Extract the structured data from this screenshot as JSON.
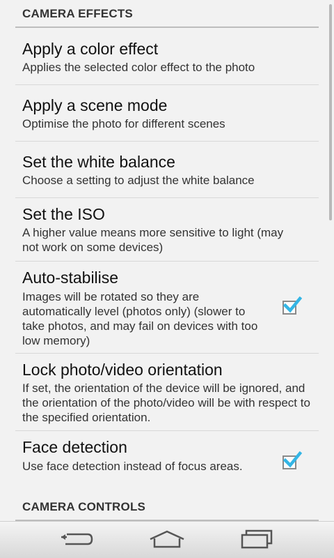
{
  "sections": {
    "camera_effects": "CAMERA EFFECTS",
    "camera_controls": "CAMERA CONTROLS"
  },
  "prefs": {
    "color_effect": {
      "title": "Apply a color effect",
      "summary": "Applies the selected color effect to the photo"
    },
    "scene_mode": {
      "title": "Apply a scene mode",
      "summary": "Optimise the photo for different scenes"
    },
    "white_balance": {
      "title": "Set the white balance",
      "summary": "Choose a setting to adjust the white balance"
    },
    "iso": {
      "title": "Set the ISO",
      "summary": "A higher value means more sensitive to light (may not work on some devices)"
    },
    "auto_stabilise": {
      "title": "Auto-stabilise",
      "summary": "Images will be rotated so they are automatically level (photos only) (slower to take photos, and may fail on devices with too low memory)",
      "checked": true
    },
    "lock_orientation": {
      "title": "Lock photo/video orientation",
      "summary": "If set, the orientation of the device will be ignored, and the orientation of the photo/video will be with respect to the specified orientation."
    },
    "face_detection": {
      "title": "Face detection",
      "summary": "Use face detection instead of focus areas.",
      "checked": true
    }
  },
  "navbar": {
    "back_icon": "back-icon",
    "home_icon": "home-icon",
    "recents_icon": "recents-icon"
  },
  "colors": {
    "background": "#f2f2f2",
    "checkmark": "#33b5e5",
    "divider": "#d8d8d8"
  }
}
